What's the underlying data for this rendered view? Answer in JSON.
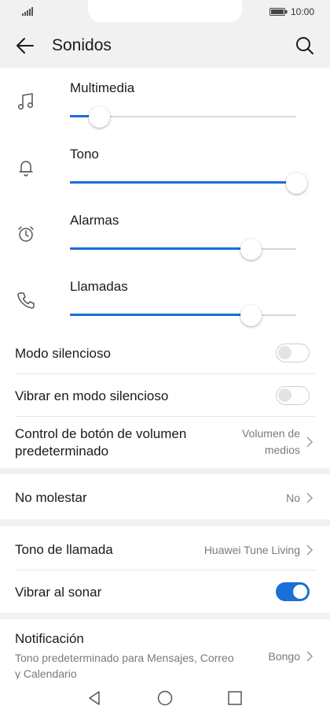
{
  "status": {
    "time": "10:00",
    "icons": [
      "signal-icon",
      "battery-icon"
    ]
  },
  "header": {
    "title": "Sonidos",
    "back_icon": "back-arrow-icon",
    "search_icon": "search-icon"
  },
  "volume": [
    {
      "label": "Multimedia",
      "icon": "music-note-icon",
      "level": 0.13
    },
    {
      "label": "Tono",
      "icon": "bell-icon",
      "level": 1.0
    },
    {
      "label": "Alarmas",
      "icon": "alarm-clock-icon",
      "level": 0.8
    },
    {
      "label": "Llamadas",
      "icon": "phone-icon",
      "level": 0.8
    }
  ],
  "settings": {
    "silent_mode": {
      "label": "Modo silencioso",
      "enabled": false
    },
    "vibrate_silent": {
      "label": "Vibrar en modo silencioso",
      "enabled": false
    },
    "volume_button": {
      "label_line1": "Control de botón de volumen",
      "label_line2": "predeterminado",
      "value_line1": "Volumen de",
      "value_line2": "medios"
    },
    "dnd": {
      "label": "No molestar",
      "value": "No"
    },
    "ringtone": {
      "label": "Tono de llamada",
      "value": "Huawei Tune Living"
    },
    "vibrate_ring": {
      "label": "Vibrar al sonar",
      "enabled": true
    },
    "notification": {
      "label": "Notificación",
      "sub_line1": "Tono predeterminado para Mensajes, Correo",
      "sub_line2": "y Calendario",
      "value": "Bongo"
    }
  },
  "colors": {
    "accent": "#1a6fd9",
    "background": "#f1f1f1",
    "card": "#ffffff"
  },
  "navbar": {
    "icons": [
      "nav-back-icon",
      "nav-home-icon",
      "nav-recents-icon"
    ]
  }
}
